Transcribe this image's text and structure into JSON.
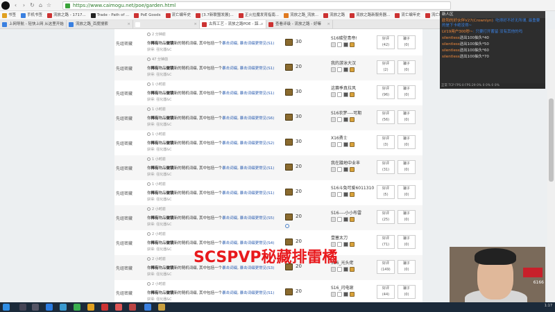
{
  "browser": {
    "url": "https://www.caimogu.net/poe/garden.html",
    "bookmarks": [
      {
        "label": "书签",
        "color": "#e0a020"
      },
      {
        "label": "手机书签",
        "color": "#3a80e0"
      },
      {
        "label": "流放之路 - 1717...",
        "color": "#c33"
      },
      {
        "label": "Trade - Path of ...",
        "color": "#222"
      },
      {
        "label": "PoE Goods",
        "color": "#c33"
      },
      {
        "label": "流亡编年史",
        "color": "#c33"
      },
      {
        "label": "[3.7新联盟发展]...",
        "color": "#c33"
      },
      {
        "label": "正火拉魔发育指南...",
        "color": "#c33"
      },
      {
        "label": "流放之路_流放...",
        "color": "#e07a20"
      },
      {
        "label": "流放之路",
        "color": "#c33"
      },
      {
        "label": "流放之路新服务器...",
        "color": "#c33"
      },
      {
        "label": "流亡编年史",
        "color": "#c33"
      },
      {
        "label": "流亡编年史",
        "color": "#c33"
      }
    ],
    "tabs": [
      {
        "label": "上网导航 - 轻快上网 从这里开始",
        "color": "#3a80e0",
        "active": false
      },
      {
        "label": "流放之路_百度搜索",
        "color": "#3a80e0",
        "active": false
      },
      {
        "label": "",
        "color": "#fff",
        "active": false
      },
      {
        "label": "古阵工艺 - 流放之路POE - 踩...",
        "color": "#c33",
        "active": true
      },
      {
        "label": "查看评级 - 流放之路 - 好嘛",
        "color": "#c33",
        "active": false
      }
    ]
  },
  "rows": [
    {
      "time": "2 分钟前",
      "author": "先组密藏",
      "desc_a": "你",
      "desc_b": "稀有",
      "desc_c": "物品",
      "desc_d": "做镜",
      "desc_e": "新的随机词缀, 其中包括一个",
      "desc_f": "暴击词缀",
      "desc_g": ", ",
      "desc_h": "暴击词缀更常见(S1)",
      "sub": "获得: 强化器&C",
      "count": "30",
      "name": "S16碳型青帝!",
      "good": "好评",
      "good_n": "(42)",
      "bad": "骗子",
      "bad_n": "(0)"
    },
    {
      "time": "47 分钟前",
      "author": "先组密藏",
      "desc_a": "你",
      "desc_b": "稀有",
      "desc_c": "物品",
      "desc_d": "做镜",
      "desc_e": "新的随机词缀, 其中包括一个",
      "desc_f": "暴击词缀",
      "desc_g": ", ",
      "desc_h": "暴击词缀更常见(S1)",
      "sub": "获得: 强化器&C",
      "count": "20",
      "name": "我的游泳大汉",
      "good": "好评",
      "good_n": "(2)",
      "bad": "骗子",
      "bad_n": "(0)"
    },
    {
      "time": "1 小时前",
      "author": "先组密藏",
      "desc_a": "你",
      "desc_b": "稀有",
      "desc_c": "物品",
      "desc_d": "做镜",
      "desc_e": "新的随机词缀, 其中包括一个",
      "desc_f": "暴击词缀",
      "desc_g": ", ",
      "desc_h": "暴击词缀更常见(S1)",
      "sub": "获得: 强化器&C",
      "count": "30",
      "name": "这赛季真拉风",
      "good": "好评",
      "good_n": "(96)",
      "bad": "骗子",
      "bad_n": "(0)"
    },
    {
      "time": "1 小时前",
      "author": "先组密藏",
      "desc_a": "你",
      "desc_b": "稀有",
      "desc_c": "物品",
      "desc_d": "做镜",
      "desc_e": "新的随机词缀, 其中包括一个",
      "desc_f": "暴击词缀",
      "desc_g": ", ",
      "desc_h": "暴击词缀更常见(S6)",
      "sub": "获得: 强化器&C",
      "count": "30",
      "name": "S16农梦----可期",
      "good": "好评",
      "good_n": "(56)",
      "bad": "骗子",
      "bad_n": "(0)"
    },
    {
      "time": "1 小时前",
      "author": "先组密藏",
      "desc_a": "你",
      "desc_b": "稀有",
      "desc_c": "物品",
      "desc_d": "做镜",
      "desc_e": "新的随机词缀, 其中包括一个",
      "desc_f": "暴击词缀",
      "desc_g": ", ",
      "desc_h": "暴击词缀更常见(S2)",
      "sub": "获得: 强化器&C",
      "count": "30",
      "name": "X16勇士",
      "good": "好评",
      "good_n": "(3)",
      "bad": "骗子",
      "bad_n": "(0)"
    },
    {
      "time": "1 小时前",
      "author": "先组密藏",
      "desc_a": "你",
      "desc_b": "稀有",
      "desc_c": "物品",
      "desc_d": "做镜",
      "desc_e": "新的随机词缀, 其中包括一个",
      "desc_f": "暴击词缀",
      "desc_g": ", ",
      "desc_h": "暴击词缀更常见(S1)",
      "sub": "获得: 强化器&C",
      "count": "20",
      "name": "我在蹭地中业丰",
      "good": "好评",
      "good_n": "(31)",
      "bad": "骗子",
      "bad_n": "(0)"
    },
    {
      "time": "1 小时前",
      "author": "先组密藏",
      "desc_a": "你",
      "desc_b": "稀有",
      "desc_c": "物品",
      "desc_d": "做镜",
      "desc_e": "新的随机词缀, 其中包括一个",
      "desc_f": "暴击词缀",
      "desc_g": ", ",
      "desc_h": "暴击词缀更常见(S1)",
      "sub": "获得: 强化器&C",
      "count": "20",
      "name": "S16斗兔可爱6011310",
      "good": "好评",
      "good_n": "(5)",
      "bad": "骗子",
      "bad_n": "(0)"
    },
    {
      "time": "2 小时前",
      "author": "先组密藏",
      "desc_a": "你",
      "desc_b": "稀有",
      "desc_c": "物品",
      "desc_d": "做镜",
      "desc_e": "新的随机词缀, 其中包括一个",
      "desc_f": "暴击词缀",
      "desc_g": ", ",
      "desc_h": "暴击词缀更常见(S5)",
      "sub": "获得: 强化器&C",
      "count": "20",
      "name": "S16----小小布雷",
      "good": "好评",
      "good_n": "(25)",
      "bad": "骗子",
      "bad_n": "(0)"
    },
    {
      "time": "2 小时前",
      "author": "先组密藏",
      "desc_a": "你",
      "desc_b": "稀有",
      "desc_c": "物品",
      "desc_d": "做镜",
      "desc_e": "新的随机词缀, 其中包括一个",
      "desc_f": "暴击词缀",
      "desc_g": ", ",
      "desc_h": "暴击词缀更常见(S4)",
      "sub": "获得: 强化器&C",
      "count": "20",
      "name": "壹塞太刀",
      "good": "好评",
      "good_n": "(71)",
      "bad": "骗子",
      "bad_n": "(0)"
    },
    {
      "time": "2 小时前",
      "author": "先组密藏",
      "desc_a": "你",
      "desc_b": "稀有",
      "desc_c": "物品",
      "desc_d": "做镜",
      "desc_e": "新的随机词缀, 其中包括一个",
      "desc_f": "暴击词缀",
      "desc_g": ", ",
      "desc_h": "暴击词缀更常见(S3)",
      "sub": "获得: 强化器&C",
      "count": "20",
      "name": "S16_光头佬",
      "good": "好评",
      "good_n": "(149)",
      "bad": "骗子",
      "bad_n": "(0)"
    },
    {
      "time": "2 小时前",
      "author": "先组密藏",
      "desc_a": "你",
      "desc_b": "稀有",
      "desc_c": "物品",
      "desc_d": "做镜",
      "desc_e": "新的随机词缀, 其中包括一个",
      "desc_f": "暴击词缀",
      "desc_g": ", ",
      "desc_h": "暴击词缀更常见(S1)",
      "sub": "获得: 强化器&C",
      "count": "20",
      "name": "S16_闪电谢",
      "good": "好评",
      "good_n": "(44)",
      "bad": "骗子",
      "bad_n": "(0)"
    }
  ],
  "overlay_caption": "SCSPVP秘藏排雷橘",
  "chat": {
    "header": "新人区",
    "messages": [
      {
        "user": "欧阳的好伙伴V27(Crownlyn)",
        "text": ": 吃得好不好无所谓, 最重要的是下卡绝没得~"
      },
      {
        "user": "LV19用户300秒~",
        "text": ": 只要打开蓄留 没有其他的吗"
      },
      {
        "user": "silentless",
        "text": "送出100抽头*40"
      },
      {
        "user": "silentless",
        "text": "送出100抽头*50"
      },
      {
        "user": "silentless",
        "text": "送出100抽头*60"
      },
      {
        "user": "silentless",
        "text": "送出100抽头*70"
      }
    ],
    "stats": "正常 TCP FPS:0 FPS:29 0% 0 0% 0 0%"
  },
  "cam": {
    "number": "6166"
  },
  "taskbar": {
    "time": "1:17"
  }
}
